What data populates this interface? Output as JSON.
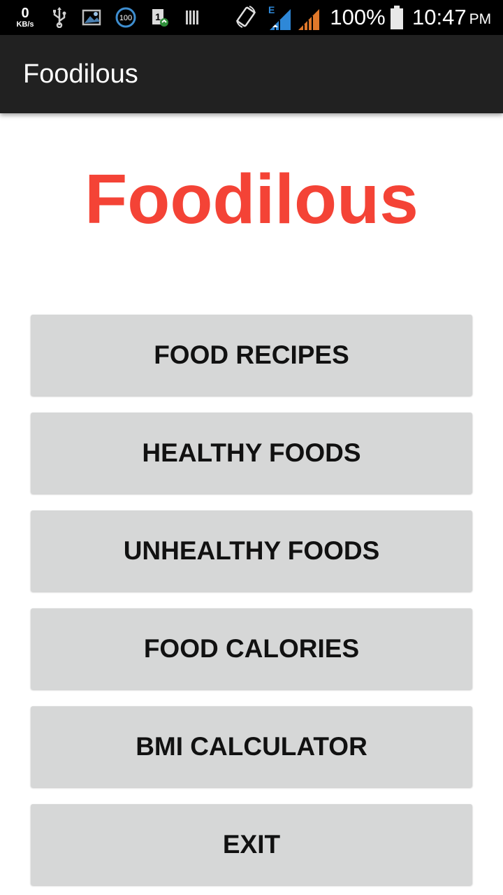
{
  "status_bar": {
    "net_speed_value": "0",
    "net_speed_unit": "KB/s",
    "notification_badge": "100",
    "battery_percent": "100%",
    "time": "10:47",
    "ampm": "PM",
    "network_type": "E",
    "icons": [
      "usb-icon",
      "image-icon",
      "data-saver-icon",
      "sim-icon",
      "barcode-icon",
      "rotate-icon",
      "signal-icon",
      "signal-icon",
      "battery-icon"
    ]
  },
  "app_bar": {
    "title": "Foodilous"
  },
  "main": {
    "headline": "Foodilous",
    "buttons": [
      {
        "label": "FOOD RECIPES"
      },
      {
        "label": "HEALTHY FOODS"
      },
      {
        "label": "UNHEALTHY FOODS"
      },
      {
        "label": "FOOD CALORIES"
      },
      {
        "label": "BMI CALCULATOR"
      },
      {
        "label": "EXIT"
      }
    ]
  },
  "colors": {
    "headline": "#f44336",
    "app_bar": "#212121",
    "button_bg": "#d6d7d7",
    "signal_blue": "#2e88d8",
    "signal_orange": "#e0782a"
  }
}
